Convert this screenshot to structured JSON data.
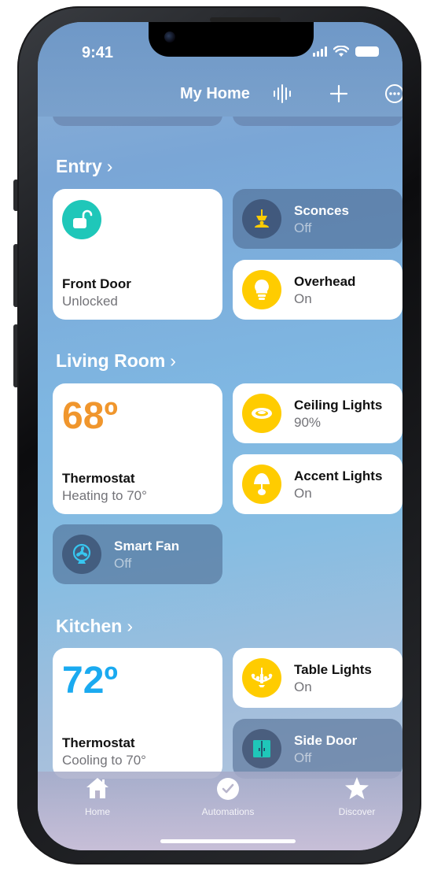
{
  "status_bar": {
    "time": "9:41"
  },
  "nav": {
    "title": "My Home"
  },
  "sections": {
    "entry": {
      "title": "Entry",
      "front_door": {
        "name": "Front Door",
        "status": "Unlocked"
      },
      "sconces": {
        "name": "Sconces",
        "status": "Off"
      },
      "overhead": {
        "name": "Overhead",
        "status": "On"
      }
    },
    "living_room": {
      "title": "Living Room",
      "thermostat": {
        "temperature": "68º",
        "name": "Thermostat",
        "status": "Heating to 70°"
      },
      "ceiling_lights": {
        "name": "Ceiling Lights",
        "status": "90%"
      },
      "accent_lights": {
        "name": "Accent Lights",
        "status": "On"
      },
      "smart_fan": {
        "name": "Smart Fan",
        "status": "Off"
      }
    },
    "kitchen": {
      "title": "Kitchen",
      "thermostat": {
        "temperature": "72º",
        "name": "Thermostat",
        "status": "Cooling to 70°"
      },
      "table_lights": {
        "name": "Table Lights",
        "status": "On"
      },
      "side_door": {
        "name": "Side Door",
        "status": "Off"
      }
    }
  },
  "tabs": [
    {
      "label": "Home",
      "icon": "house-icon"
    },
    {
      "label": "Automations",
      "icon": "clock-icon"
    },
    {
      "label": "Discover",
      "icon": "star-icon"
    }
  ],
  "colors": {
    "heating": "#F0962D",
    "cooling": "#1AAAF0",
    "lock_teal": "#1FC7B9",
    "light_yellow": "#FFCC00"
  }
}
